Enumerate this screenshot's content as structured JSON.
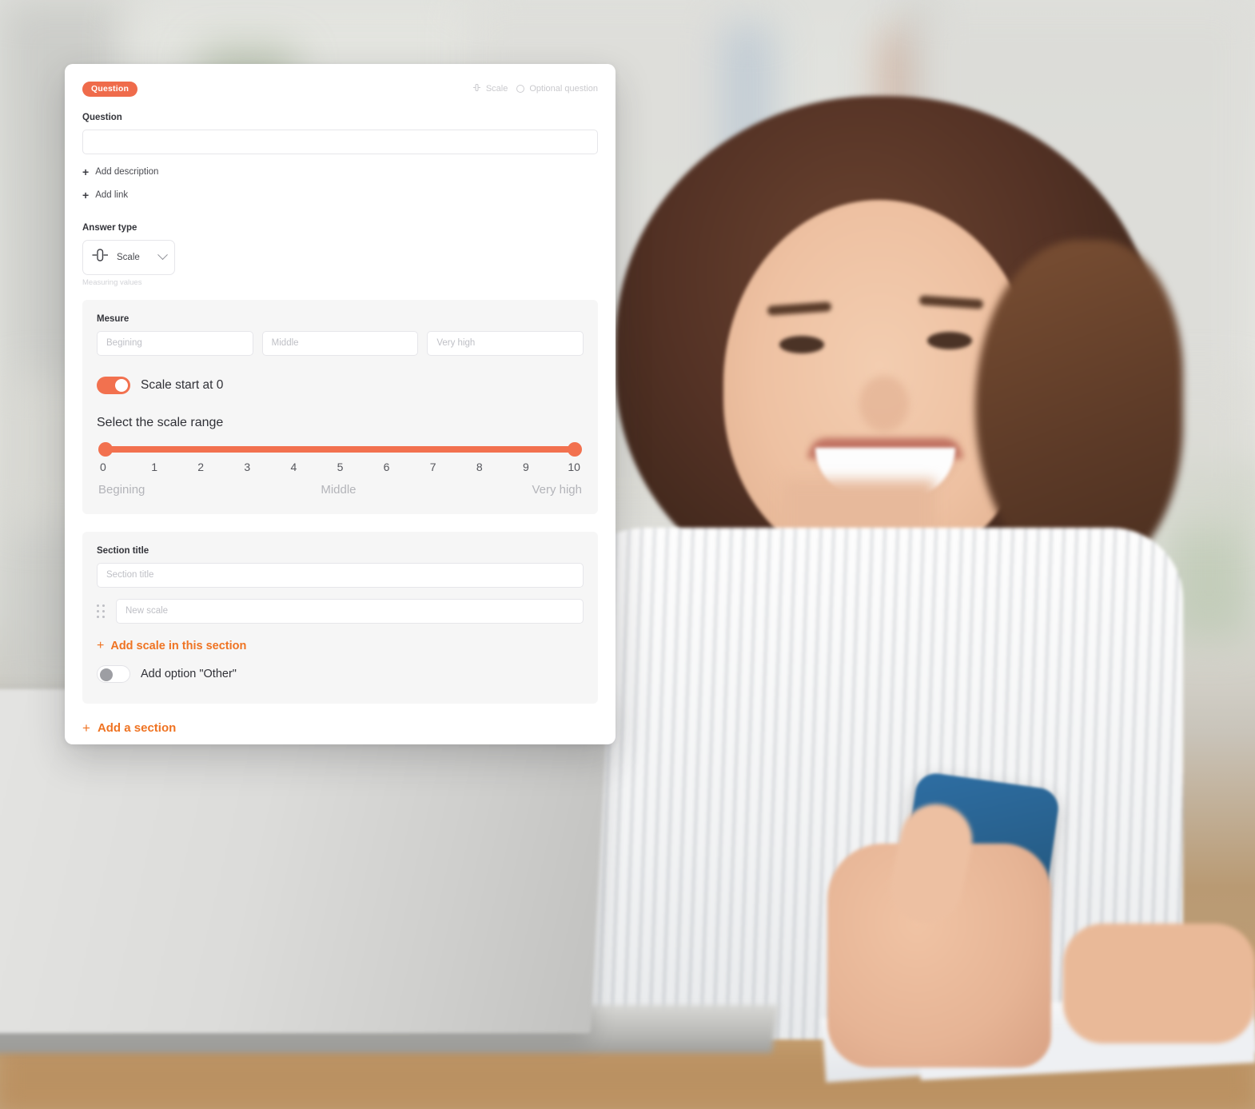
{
  "card": {
    "badge": "Question",
    "header_right": {
      "scale_icon": "scale-icon",
      "scale_label": "Scale",
      "optional_radio": "radio-unchecked-icon",
      "optional_label": "Optional question"
    },
    "question": {
      "label": "Question",
      "value": "",
      "placeholder": ""
    },
    "add_description": {
      "icon": "plus-icon",
      "label": "Add description"
    },
    "add_link": {
      "icon": "plus-icon",
      "label": "Add link"
    },
    "answer_type": {
      "label": "Answer type",
      "icon": "scale-slider-icon",
      "selected": "Scale",
      "chevron": "chevron-down-icon",
      "helper": "Measuring values"
    },
    "measure_panel": {
      "label": "Mesure",
      "inputs": [
        {
          "placeholder": "Begining",
          "value": ""
        },
        {
          "placeholder": "Middle",
          "value": ""
        },
        {
          "placeholder": "Very high",
          "value": ""
        }
      ],
      "start_toggle": {
        "label": "Scale start at 0",
        "state": "on"
      },
      "range_title": "Select the scale range",
      "anchors": {
        "left": "Begining",
        "middle": "Middle",
        "right": "Very high"
      }
    },
    "section_panel": {
      "label": "Section title",
      "title_input": {
        "placeholder": "Section title",
        "value": ""
      },
      "drag_icon": "drag-handle-icon",
      "scale_input": {
        "placeholder": "New scale",
        "value": ""
      },
      "add_scale": {
        "icon": "plus-icon",
        "label": "Add scale in this section"
      },
      "other_toggle": {
        "label": "Add option \"Other\"",
        "state": "off"
      }
    },
    "add_a_section": {
      "icon": "plus-icon",
      "label": "Add a section"
    }
  },
  "chart_data": {
    "type": "slider-scale",
    "title": "Select the scale range",
    "categories": [
      "0",
      "1",
      "2",
      "3",
      "4",
      "5",
      "6",
      "7",
      "8",
      "9",
      "10"
    ],
    "values": [
      0,
      1,
      2,
      3,
      4,
      5,
      6,
      7,
      8,
      9,
      10
    ],
    "selected_min": 0,
    "selected_max": 10,
    "anchor_labels": [
      "Begining",
      "Middle",
      "Very high"
    ],
    "xlabel": "",
    "ylabel": "",
    "xlim": [
      0,
      10
    ]
  },
  "colors": {
    "accent_orange": "#ef7322",
    "badge_coral": "#ef6b4b",
    "slider_coral": "#f2714f",
    "panel_grey": "#f6f6f6",
    "text_dark": "#33343a",
    "text_muted": "#b3b4b9"
  }
}
